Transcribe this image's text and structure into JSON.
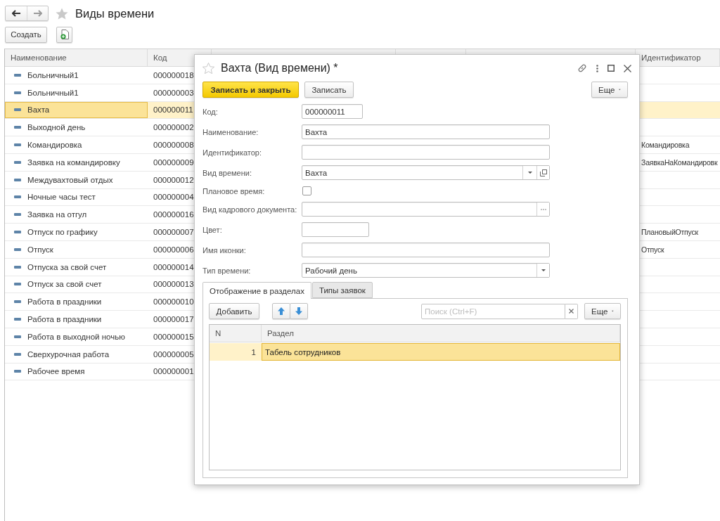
{
  "window": {
    "title": "Виды времени"
  },
  "toolbar": {
    "create_button": "Создать"
  },
  "list": {
    "columns": [
      "Наименование",
      "Код",
      "Идентификатор"
    ],
    "rows": [
      {
        "name": "Больничный1",
        "code": "000000018",
        "selected": false
      },
      {
        "name": "Больничный1",
        "code": "000000003",
        "selected": false
      },
      {
        "name": "Вахта",
        "code": "000000011",
        "selected": true
      },
      {
        "name": "Выходной день",
        "code": "000000002",
        "selected": false
      },
      {
        "name": "Командировка",
        "code": "000000008",
        "identifier": "Командировка",
        "selected": false
      },
      {
        "name": "Заявка на командировку",
        "code": "000000009",
        "identifier": "ЗаявкаНаКомандировк",
        "selected": false
      },
      {
        "name": "Междувахтовый отдых",
        "code": "000000012",
        "selected": false
      },
      {
        "name": "Ночные часы тест",
        "code": "000000004",
        "selected": false
      },
      {
        "name": "Заявка на отгул",
        "code": "000000016",
        "selected": false
      },
      {
        "name": "Отпуск по графику",
        "code": "000000007",
        "identifier": "ПлановыйОтпуск",
        "selected": false
      },
      {
        "name": "Отпуск",
        "code": "000000006",
        "identifier": "Отпуск",
        "selected": false
      },
      {
        "name": "Отпуска за свой счет",
        "code": "000000014",
        "selected": false
      },
      {
        "name": "Отпуск за свой счет",
        "code": "000000013",
        "selected": false
      },
      {
        "name": "Работа в праздники",
        "code": "000000010",
        "selected": false
      },
      {
        "name": "Работа в праздники",
        "code": "000000017",
        "selected": false
      },
      {
        "name": "Работа в выходной ночью",
        "code": "000000015",
        "selected": false
      },
      {
        "name": "Сверхурочная работа",
        "code": "000000005",
        "selected": false
      },
      {
        "name": "Рабочее время",
        "code": "000000001",
        "selected": false
      }
    ]
  },
  "dialog": {
    "title": "Вахта (Вид времени) *",
    "buttons": [
      {
        "label": "Записать и закрыть",
        "kind": "primary"
      },
      {
        "label": "Записать",
        "kind": "default"
      },
      {
        "label": "Еще",
        "kind": "menu"
      }
    ],
    "fields": [
      {
        "label": "Код:",
        "kind": "code",
        "value": "000000011"
      },
      {
        "label": "Наименование:",
        "kind": "text",
        "value": "Вахта"
      },
      {
        "label": "Идентификатор:",
        "kind": "text"
      },
      {
        "label": "Вид времени:",
        "kind": "reference",
        "value": "Вахта"
      },
      {
        "label": "Плановое время:",
        "kind": "checkbox",
        "checked": false
      },
      {
        "label": "Вид кадрового документа:",
        "kind": "picker"
      },
      {
        "label": "Цвет:",
        "kind": "color"
      },
      {
        "label": "Имя иконки:",
        "kind": "text"
      },
      {
        "label": "Тип времени:",
        "kind": "dropdown",
        "value": "Рабочий день"
      }
    ],
    "tabs": [
      {
        "label": "Отображение в разделах",
        "selected": true
      },
      {
        "label": "Типы заявок",
        "selected": false
      }
    ],
    "tab_panel": {
      "add_button": "Добавить",
      "search": {
        "placeholder": "Поиск (Ctrl+F)"
      },
      "more_button": "Еще",
      "table": {
        "columns": [
          "N",
          "Раздел"
        ],
        "rows": [
          {
            "n": "1",
            "section": "Табель сотрудников",
            "selected": true
          }
        ]
      }
    }
  }
}
